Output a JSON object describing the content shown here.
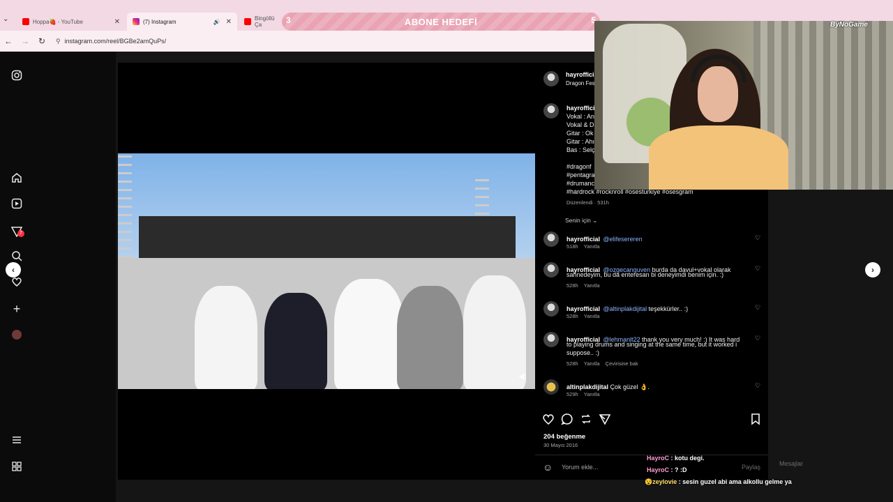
{
  "browser": {
    "tabs": [
      {
        "label": "Hoppa🍓 - YouTube",
        "close": "✕",
        "favicon_color": "#ff0000"
      },
      {
        "label": "(7) Instagram",
        "close": "✕",
        "favicon_color": "#d62976",
        "audio": "🔊"
      },
      {
        "label": "Bingöllü Ça",
        "favicon_color": "#ff0000"
      }
    ],
    "url": "instagram.com/reel/BGBe2amQuPs/",
    "nav": {
      "back": "←",
      "forward": "→",
      "reload": "↻",
      "menu": "⌄"
    }
  },
  "overlay": {
    "banner_title": "ABONE HEDEFİ",
    "banner_start": "3",
    "banner_end": "5",
    "cam_brand": "ByNoGame",
    "chat": [
      {
        "user": "HayroC",
        "message": " : kotu degi."
      },
      {
        "user": "HayroC",
        "message": " : ? :D"
      },
      {
        "user": "zeylovie",
        "message": " : sesin guzel abi ama alkollu gelme ya"
      }
    ]
  },
  "sidebar": {
    "icons": [
      "instagram-icon",
      "home-icon",
      "reels-icon",
      "messages-icon",
      "search-icon",
      "notifications-icon",
      "create-icon",
      "profile-icon",
      "menu-icon",
      "more-icon"
    ],
    "badge": "7"
  },
  "post": {
    "author": "hayrofficial",
    "location": "Dragon Fest",
    "caption_lines": [
      "Vokal : An",
      "Vokal & D",
      "Gitar : Ok",
      "Gitar : Ahı",
      "Bas : Selçı"
    ],
    "hashtag_lines": [
      "#dragonf",
      "#pentagra",
      "#drumanc",
      "#hardrock #rocknroll #osesturkiye #osesgram"
    ],
    "edited": "Düzenlendi · 531h",
    "sort": "Senin için ⌄",
    "comments": [
      {
        "user": "hayrofficial",
        "mention": "@elifesereren",
        "text": "",
        "text2": "",
        "age": "518h",
        "reply": "Yanıtla",
        "translate": ""
      },
      {
        "user": "hayrofficial",
        "mention": "@ozgecanguven",
        "text": " burda da davul+vokal olarak",
        "text2": "sahnedeyim, bu da enteresan bi deneyimdi benim için. :)",
        "age": "528h",
        "reply": "Yanıtla",
        "translate": ""
      },
      {
        "user": "hayrofficial",
        "mention": "@altinplakdijital",
        "text": " teşekkürler.. :)",
        "text2": "",
        "age": "528h",
        "reply": "Yanıtla",
        "translate": ""
      },
      {
        "user": "hayrofficial",
        "mention": "@lehmanlt22",
        "text": " thank you very much! :) It was hard",
        "text2": "to playing drums and singing at the same time, but it worked i",
        "text3": "suppose.. :)",
        "age": "528h",
        "reply": "Yanıtla",
        "translate": "Çevirisine bak"
      },
      {
        "user": "altinplakdijital",
        "mention": "",
        "text": " Çok güzel 👌.",
        "text2": "",
        "age": "529h",
        "reply": "Yanıtla",
        "translate": ""
      }
    ],
    "likes": "204 beğenme",
    "date": "30 Mayıs 2016",
    "comment_placeholder": "Yorum ekle...",
    "share_label": "Paylaş",
    "messages_label": "Mesajlar"
  },
  "colors": {
    "accent_link": "#8ab4ff",
    "chat_user": "#ff9ed6",
    "banner": "#e9a3b3",
    "tabbar": "#f2d9e3"
  }
}
